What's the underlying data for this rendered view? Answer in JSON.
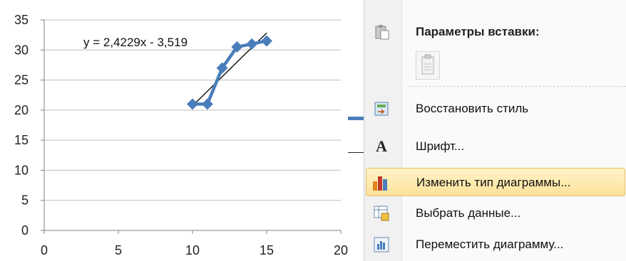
{
  "chart_data": {
    "type": "scatter",
    "x_ticks": [
      "0",
      "5",
      "10",
      "15",
      "20"
    ],
    "y_ticks": [
      "0",
      "5",
      "10",
      "15",
      "20",
      "25",
      "30",
      "35"
    ],
    "xlim": [
      0,
      20
    ],
    "ylim": [
      0,
      35
    ],
    "grid": "horizontal",
    "series": [
      {
        "x": [
          10,
          11,
          12,
          13,
          14,
          15
        ],
        "y": [
          21,
          21,
          27,
          30.5,
          31,
          31.5
        ],
        "color": "#4a7ebb",
        "marker": "diamond"
      }
    ],
    "trendline": {
      "slope": 2.4229,
      "intercept": -3.519,
      "color": "#000000",
      "x": [
        10,
        15
      ]
    },
    "annotation": "y = 2,4229x - 3,519"
  },
  "menu": {
    "paste_header": "Параметры вставки:",
    "items": [
      {
        "label": "Восстановить стиль",
        "icon": "reset-style-icon"
      },
      {
        "label": "Шрифт...",
        "icon": "font-icon"
      },
      {
        "label": "Изменить тип диаграммы...",
        "icon": "chart-type-icon",
        "highlighted": true
      },
      {
        "label": "Выбрать данные...",
        "icon": "select-data-icon"
      },
      {
        "label": "Переместить диаграмму...",
        "icon": "move-chart-icon"
      }
    ]
  }
}
